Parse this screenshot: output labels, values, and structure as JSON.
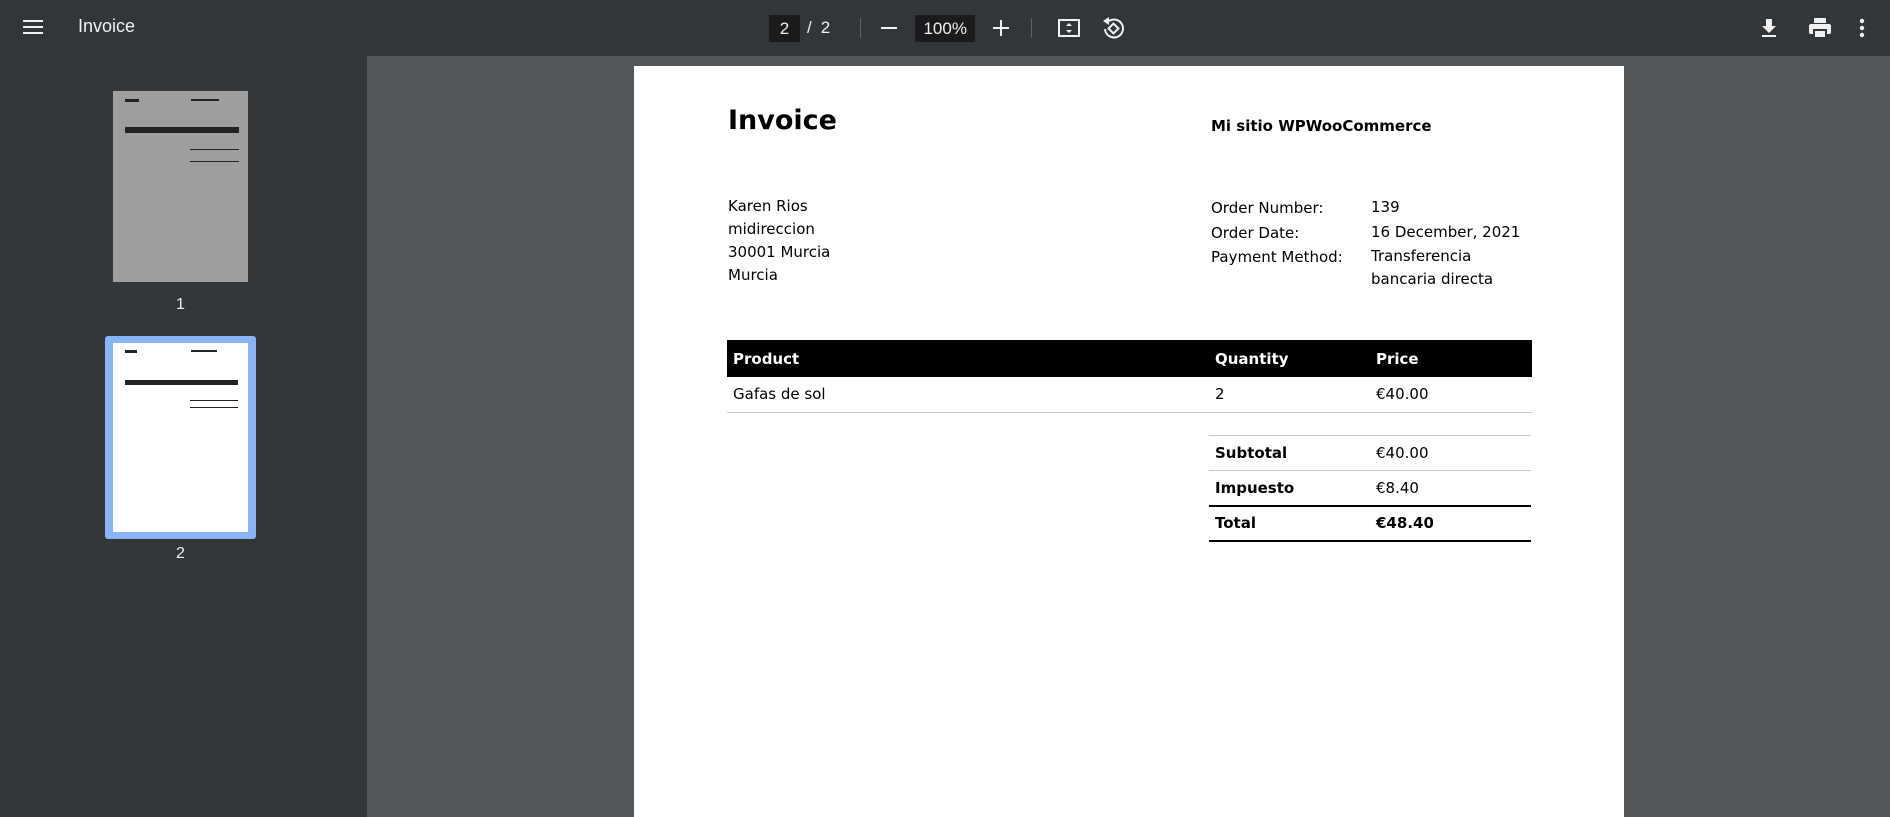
{
  "toolbar": {
    "title": "Invoice",
    "current_page": "2",
    "page_separator": "/",
    "total_pages": "2",
    "zoom": "100%",
    "icons": [
      "menu-icon",
      "minus-icon",
      "plus-icon",
      "fit-page-icon",
      "rotate-icon",
      "download-icon",
      "print-icon",
      "more-vert-icon"
    ]
  },
  "sidebar": {
    "thumbnails": [
      {
        "label": "1"
      },
      {
        "label": "2",
        "selected": true
      }
    ],
    "selected_color": "#8ab4f8"
  },
  "invoice": {
    "title": "Invoice",
    "shop_name": "Mi sitio WPWooCommerce",
    "address": [
      "Karen Rios",
      "midireccion",
      "30001 Murcia",
      "Murcia"
    ],
    "meta": [
      {
        "label": "Order Number:",
        "value": "139"
      },
      {
        "label": "Order Date:",
        "value": "16 December, 2021"
      },
      {
        "label": "Payment Method:",
        "value": "Transferencia bancaria directa"
      }
    ],
    "items_header": {
      "product": "Product",
      "quantity": "Quantity",
      "price": "Price"
    },
    "items": [
      {
        "product": "Gafas de sol",
        "quantity": "2",
        "price": "€40.00"
      }
    ],
    "totals": [
      {
        "label": "Subtotal",
        "value": "€40.00"
      },
      {
        "label": "Impuesto",
        "value": "€8.40"
      },
      {
        "label": "Total",
        "value": "€48.40"
      }
    ]
  }
}
